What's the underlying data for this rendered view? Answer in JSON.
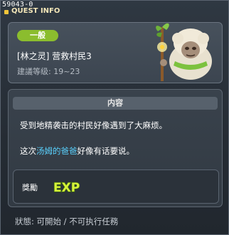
{
  "quest_id": "59043-0",
  "window_title": "QUEST INFO",
  "difficulty": "一般",
  "quest": {
    "title": "[林之灵] 营救村民3",
    "level_requirement": "建議等级: 19~23"
  },
  "content": {
    "header": "内容",
    "line1": "受到地精袭击的村民好像遇到了大麻烦。",
    "line2_prefix": "这次",
    "line2_highlight": "汤姆的爸爸",
    "line2_suffix": "好像有话要说。"
  },
  "reward": {
    "label": "獎勵",
    "icon_text": "EXP"
  },
  "status": "狀態: 可開始 / 不可执行任務",
  "colors": {
    "accent_badge": "#8bbd2e",
    "highlight_text": "#5ad2ff",
    "title_text": "#f3e6b8"
  },
  "icons": {
    "npc": "sheep-villager-with-staff-icon",
    "reward": "exp-icon"
  }
}
